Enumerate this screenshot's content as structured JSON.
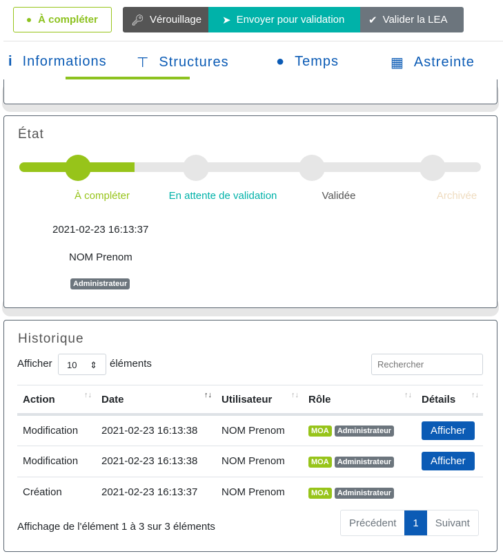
{
  "header": {
    "status": "À compléter",
    "lock": "Vérouillage",
    "send": "Envoyer pour validation",
    "validate": "Valider la LEA"
  },
  "tabs": [
    {
      "label": "Informations",
      "icon": "info-icon"
    },
    {
      "label": "Structures",
      "icon": "sitemap-icon"
    },
    {
      "label": "Temps",
      "icon": "clock-icon"
    },
    {
      "label": "Astreinte",
      "icon": "calendar-icon"
    }
  ],
  "etat": {
    "title": "État",
    "steps": [
      "À compléter",
      "En attente de validation",
      "Validée",
      "Archivée"
    ],
    "progress": 0.25,
    "date": "2021-02-23 16:13:37",
    "user": "NOM Prenom",
    "role": "Administrateur"
  },
  "historique": {
    "title": "Historique",
    "show_label": "Afficher",
    "page_size": "10",
    "elements_label": "éléments",
    "search_placeholder": "Rechercher",
    "columns": [
      "Action",
      "Date",
      "Utilisateur",
      "Rôle",
      "Détails"
    ],
    "rows": [
      {
        "action": "Modification",
        "date": "2021-02-23 16:13:38",
        "user": "NOM Prenom",
        "role1": "MOA",
        "role2": "Administrateur",
        "details": "Afficher"
      },
      {
        "action": "Modification",
        "date": "2021-02-23 16:13:38",
        "user": "NOM Prenom",
        "role1": "MOA",
        "role2": "Administrateur",
        "details": "Afficher"
      },
      {
        "action": "Création",
        "date": "2021-02-23 16:13:37",
        "user": "NOM Prenom",
        "role1": "MOA",
        "role2": "Administrateur"
      }
    ],
    "info": "Affichage de l'élément 1 à 3 sur 3 éléments",
    "prev": "Précédent",
    "page": "1",
    "next": "Suivant"
  }
}
